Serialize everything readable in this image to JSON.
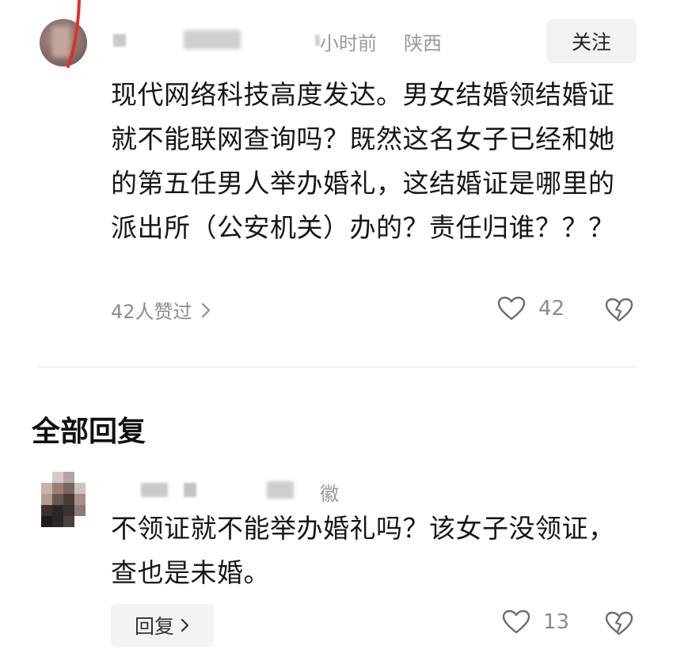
{
  "comment": {
    "time": "小时前",
    "location": "陕西",
    "follow_label": "关注",
    "text": "现代网络科技高度发达。男女结婚领结婚证就不能联网查询吗？既然这名女子已经和她的第五任男人举办婚礼，这结婚证是哪里的派出所（公安机关）办的？责任归谁？？？",
    "likers_label": "42人赞过",
    "like_count": "42",
    "icons": [
      "chevron-right-icon",
      "heart-icon",
      "broken-heart-icon"
    ]
  },
  "replies_section": {
    "title": "全部回复"
  },
  "reply": {
    "location": "徽",
    "text": "不领证就不能举办婚礼吗？该女子没领证，查也是未婚。",
    "reply_label": "回复",
    "like_count": "13"
  },
  "colors": {
    "text": "#161616",
    "secondary": "#8c8c8c",
    "button_bg": "#f2f2f2",
    "divider": "#e6e6e6"
  }
}
